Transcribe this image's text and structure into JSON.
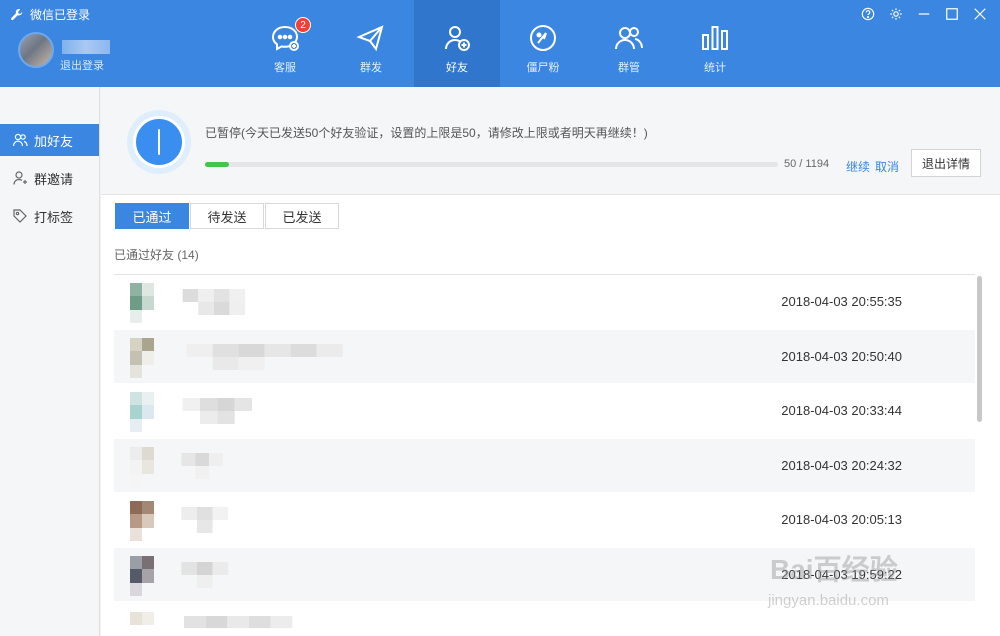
{
  "app": {
    "title": "微信已登录",
    "logout_label": "退出登录"
  },
  "nav": {
    "items": [
      {
        "label": "客服",
        "icon": "chat-icon",
        "badge": "2"
      },
      {
        "label": "群发",
        "icon": "send-icon"
      },
      {
        "label": "好友",
        "icon": "add-friend-icon",
        "active": true
      },
      {
        "label": "僵尸粉",
        "icon": "zombie-icon"
      },
      {
        "label": "群管",
        "icon": "group-icon"
      },
      {
        "label": "统计",
        "icon": "stats-icon"
      }
    ]
  },
  "sidebar": {
    "items": [
      {
        "label": "加好友",
        "icon": "add-friends-icon",
        "active": true
      },
      {
        "label": "群邀请",
        "icon": "group-invite-icon"
      },
      {
        "label": "打标签",
        "icon": "tag-icon"
      }
    ]
  },
  "progress": {
    "status": "已暂停(今天已发送50个好友验证，设置的上限是50，请修改上限或者明天再继续！)",
    "count": "50 / 1194",
    "fraction": 0.042,
    "continue_label": "继续",
    "cancel_label": "取消",
    "exit_label": "退出详情"
  },
  "tabs": [
    {
      "label": "已通过",
      "active": true
    },
    {
      "label": "待发送"
    },
    {
      "label": "已发送"
    }
  ],
  "list": {
    "title": "已通过好友",
    "count": "(14)",
    "rows": [
      {
        "time": "2018-04-03 20:55:35"
      },
      {
        "time": "2018-04-03 20:50:40"
      },
      {
        "time": "2018-04-03 20:33:44"
      },
      {
        "time": "2018-04-03 20:24:32"
      },
      {
        "time": "2018-04-03 20:05:13"
      },
      {
        "time": "2018-04-03 19:59:22"
      },
      {
        "time": ""
      }
    ]
  },
  "watermark": {
    "main": "Bai百经验",
    "sub": "jingyan.baidu.com"
  },
  "colors": {
    "accent": "#3b86e0",
    "progress": "#3fc64c",
    "badge": "#f04134"
  }
}
